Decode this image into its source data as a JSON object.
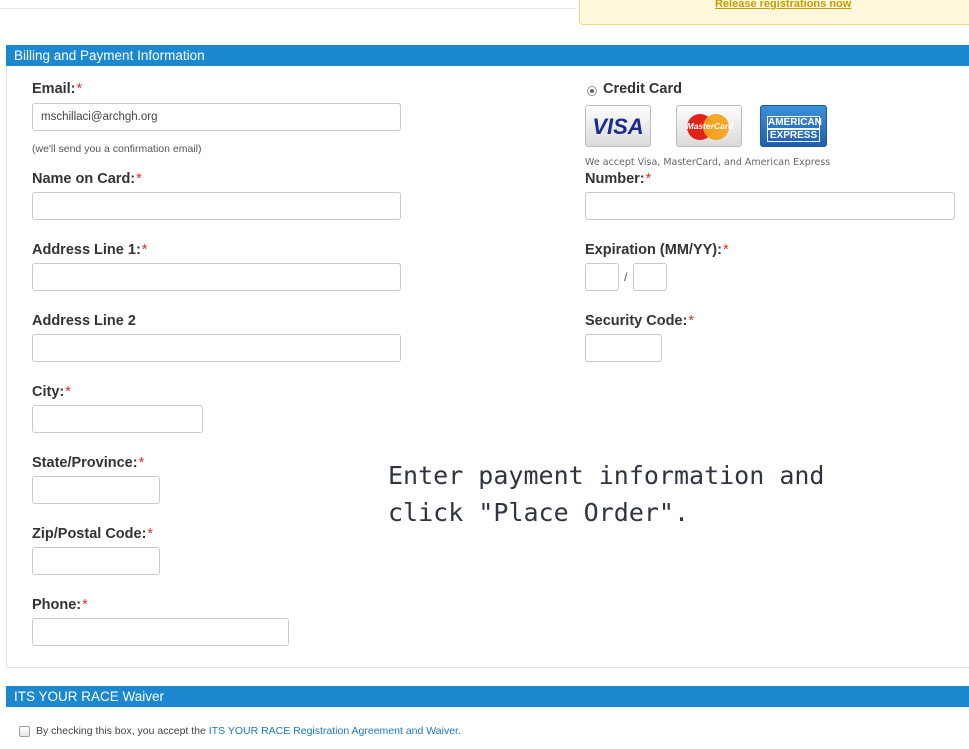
{
  "top_notice": {
    "link": "Release registrations now"
  },
  "billing": {
    "header": "Billing and Payment Information",
    "email": {
      "label": "Email:",
      "value": "mschillaci@archgh.org",
      "hint": "(we'll send you a confirmation email)"
    },
    "name_on_card": {
      "label": "Name on Card:"
    },
    "address1": {
      "label": "Address Line 1:"
    },
    "address2": {
      "label": "Address Line 2"
    },
    "city": {
      "label": "City:"
    },
    "state": {
      "label": "State/Province:"
    },
    "zip": {
      "label": "Zip/Postal Code:"
    },
    "phone": {
      "label": "Phone:"
    },
    "payment_method": {
      "label": "Credit Card",
      "selected": true
    },
    "cards": {
      "visa": "VISA",
      "mastercard": "MasterCard",
      "amex_line1": "AMERICAN",
      "amex_line2": "EXPRESS",
      "accepted_text": "We accept Visa, MasterCard, and American Express"
    },
    "number": {
      "label": "Number:"
    },
    "expiration": {
      "label": "Expiration (MM/YY):",
      "separator": "/"
    },
    "security_code": {
      "label": "Security Code:"
    },
    "required_marker": "*"
  },
  "overlay_instruction": "Enter payment information and\nclick \"Place Order\".",
  "waiver": {
    "header": "ITS YOUR RACE Waiver",
    "checkbox_text": "By checking this box, you accept the ",
    "link_text": "ITS YOUR RACE Registration Agreement and Waiver",
    "period": "."
  }
}
